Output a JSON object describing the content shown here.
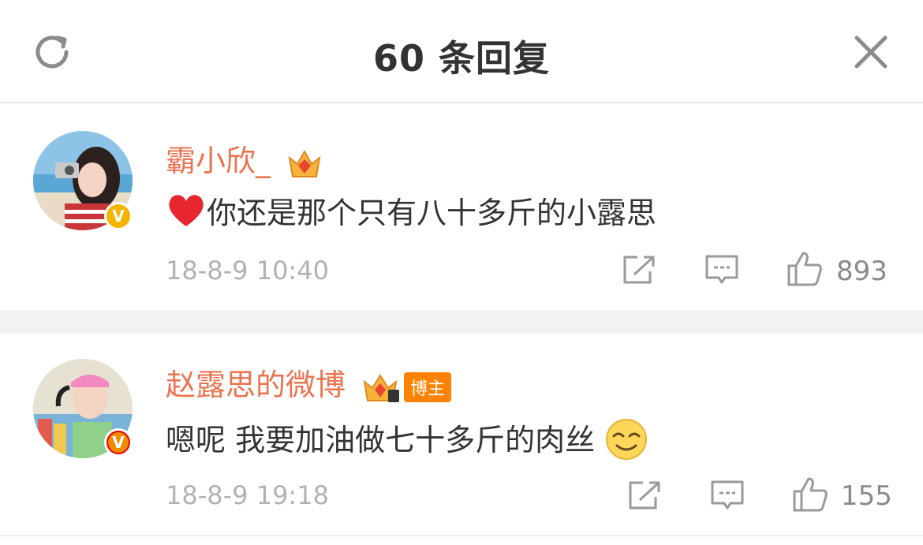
{
  "header": {
    "title": "60 条回复"
  },
  "comments": [
    {
      "username": "霸小欣_",
      "text": "你还是那个只有八十多斤的小露思",
      "leading_emoji": "heart",
      "time": "18-8-9 10:40",
      "likes": "893"
    },
    {
      "username": "赵露思的微博",
      "tag": "博主",
      "text": "嗯呢 我要加油做七十多斤的肉丝",
      "trailing_emoji": "smile",
      "time": "18-8-9 19:18",
      "likes": "155"
    }
  ],
  "colors": {
    "username": "#eb7350",
    "tag_bg": "#ff8200",
    "meta": "#b2b2b2"
  }
}
